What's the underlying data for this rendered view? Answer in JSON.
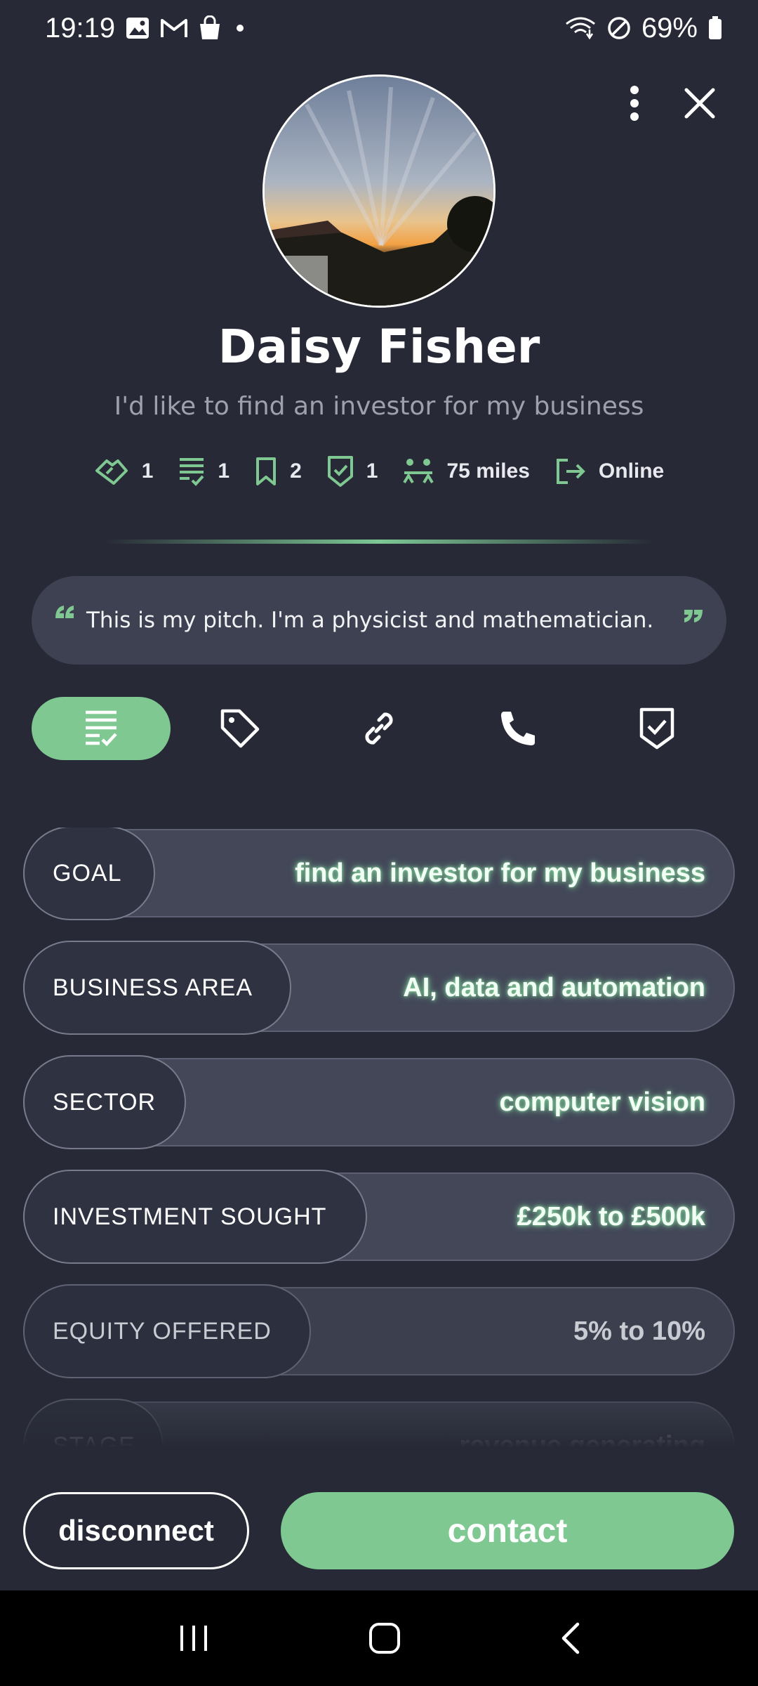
{
  "status_bar": {
    "time": "19:19",
    "battery": "69%",
    "notification_icons": [
      "gallery-icon",
      "gmail-icon",
      "shopping-bag-icon",
      "dot-icon"
    ],
    "system_icons": [
      "wifi-icon",
      "do-not-disturb-icon",
      "battery-icon"
    ]
  },
  "profile": {
    "name": "Daisy Fisher",
    "tagline": "I'd like to find an investor for my business",
    "stats": [
      {
        "icon": "handshake-icon",
        "value": "1"
      },
      {
        "icon": "checklist-icon",
        "value": "1"
      },
      {
        "icon": "bookmark-icon",
        "value": "2"
      },
      {
        "icon": "verified-shield-icon",
        "value": "1"
      },
      {
        "icon": "distance-icon",
        "value": "75 miles"
      },
      {
        "icon": "online-icon",
        "value": "Online"
      }
    ],
    "pitch": "This is my pitch. I'm a physicist and mathematician."
  },
  "tabs": [
    {
      "icon": "checklist-icon",
      "active": true
    },
    {
      "icon": "tag-icon",
      "active": false
    },
    {
      "icon": "link-icon",
      "active": false
    },
    {
      "icon": "phone-icon",
      "active": false
    },
    {
      "icon": "verified-check-icon",
      "active": false
    }
  ],
  "fields": [
    {
      "label": "GOAL",
      "value": "find an investor for my business"
    },
    {
      "label": "BUSINESS AREA",
      "value": "AI, data and automation"
    },
    {
      "label": "SECTOR",
      "value": "computer vision"
    },
    {
      "label": "INVESTMENT SOUGHT",
      "value": "£250k to £500k"
    },
    {
      "label": "EQUITY OFFERED",
      "value": "5% to 10%"
    },
    {
      "label": "STAGE",
      "value": "revenue generating"
    }
  ],
  "actions": {
    "disconnect": "disconnect",
    "contact": "contact"
  },
  "colors": {
    "background": "#272a36",
    "accent": "#7fc892",
    "pill": "#3d4152"
  }
}
